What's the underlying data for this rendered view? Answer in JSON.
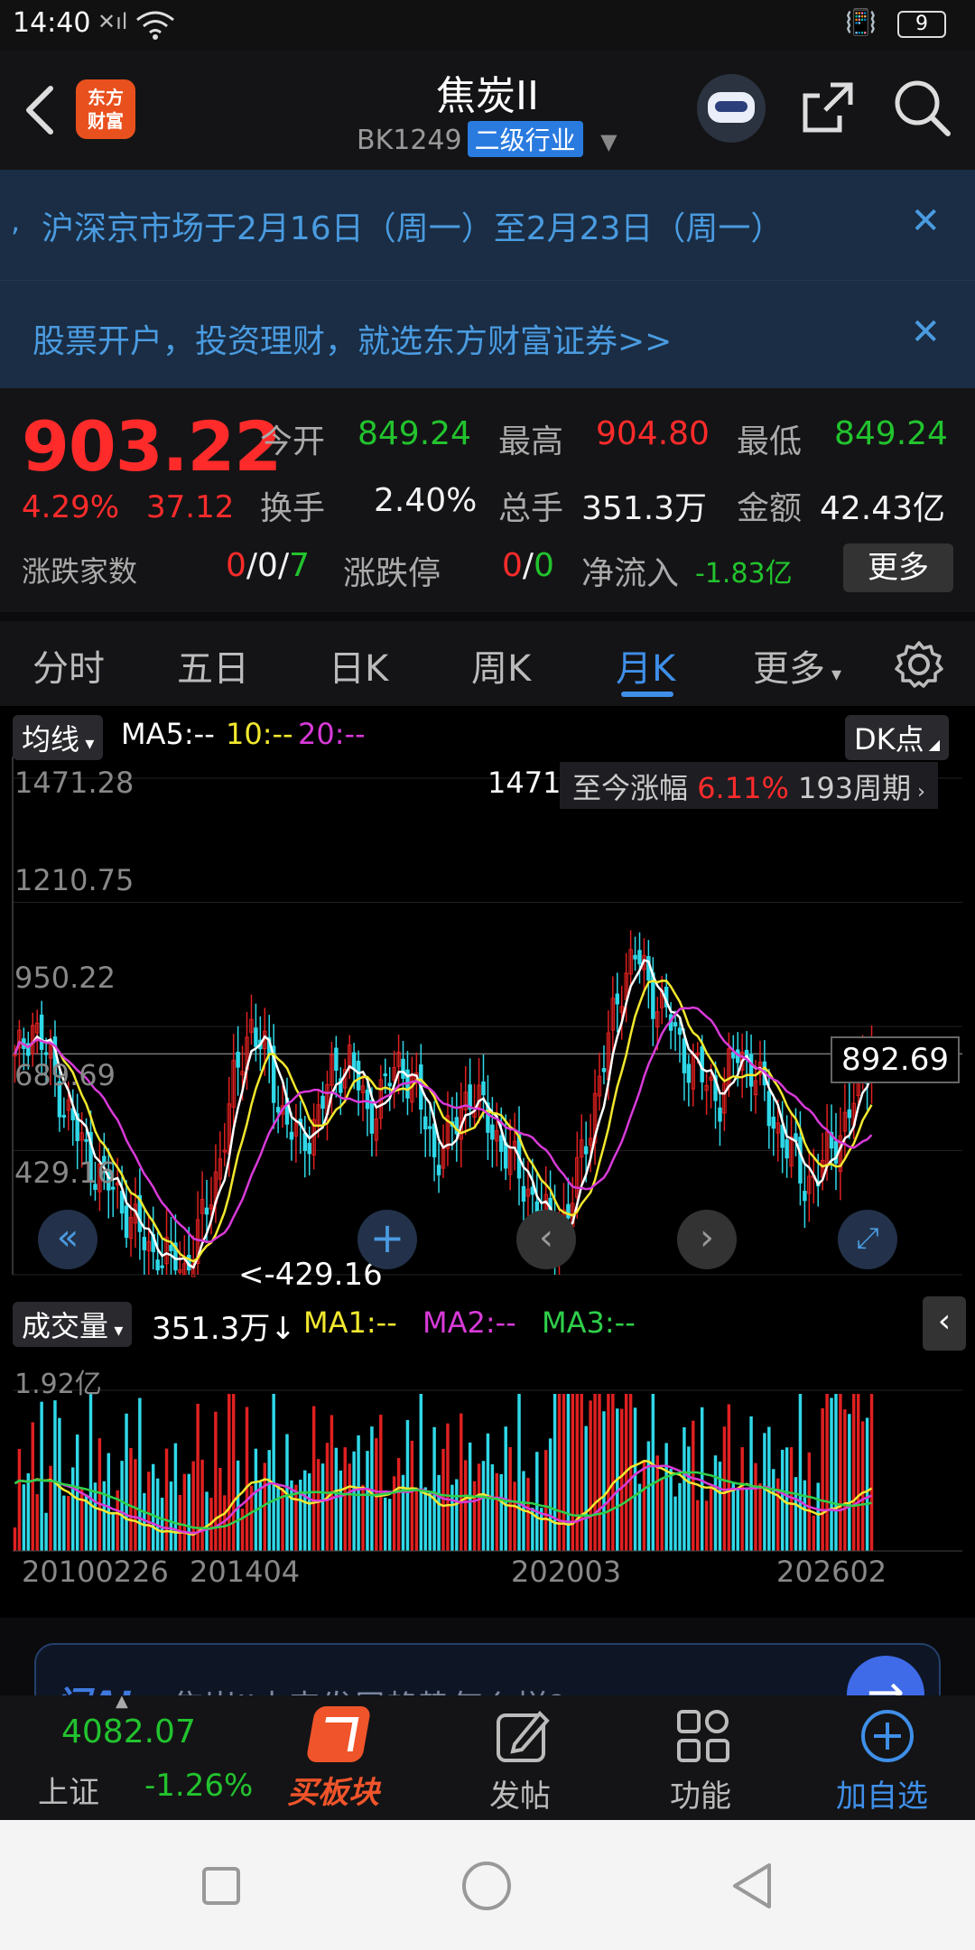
{
  "status_bar": {
    "time": "14:40",
    "battery": "9"
  },
  "header": {
    "logo_text": [
      "东方",
      "财富"
    ],
    "title": "焦炭II",
    "code": "BK1249",
    "category_tag": "二级行业"
  },
  "banners": [
    {
      "text": "沪深京市场于2月16日（周一）至2月23日（周一）"
    },
    {
      "text": "股票开户，投资理财，就选东方财富证券>>"
    }
  ],
  "quote": {
    "price": "903.22",
    "change_pct": "4.29%",
    "change_abs": "37.12",
    "fields": [
      {
        "label": "今开",
        "value": "849.24",
        "color": "green"
      },
      {
        "label": "最高",
        "value": "904.80",
        "color": "red"
      },
      {
        "label": "最低",
        "value": "849.24",
        "color": "green"
      },
      {
        "label": "换手",
        "value": "2.40%",
        "color": "white"
      },
      {
        "label": "总手",
        "value": "351.3万",
        "color": "white"
      },
      {
        "label": "金额",
        "value": "42.43亿",
        "color": "white"
      }
    ],
    "updown_label": "涨跌家数",
    "updown": {
      "up": "0",
      "flat": "0",
      "down": "7"
    },
    "limit_label": "涨跌停",
    "limit": {
      "up": "0",
      "down": "0"
    },
    "netflow_label": "净流入",
    "netflow": "-1.83亿",
    "more_label": "更多"
  },
  "tabs": [
    "分时",
    "五日",
    "日K",
    "周K",
    "月K",
    "更多"
  ],
  "active_tab": "月K",
  "chart": {
    "ma_selector": "均线",
    "ma_legend": {
      "ma5": "MA5:--",
      "ma10": "10:--",
      "ma20": "20:--"
    },
    "dk_label": "DK点",
    "y_ticks": [
      "1471.28",
      "1210.75",
      "950.22",
      "689.69",
      "429.16"
    ],
    "high_marker": "1471",
    "low_marker": "429.16",
    "period_label": "至今涨幅",
    "period_pct": "6.11%",
    "period_count": "193周期",
    "crosshair_price": "892.69",
    "vol_selector": "成交量",
    "vol_value": "351.3万↓",
    "vol_legend": {
      "ma1": "MA1:--",
      "ma2": "MA2:--",
      "ma3": "MA3:--"
    },
    "vol_y_tick": "1.92亿",
    "x_ticks": [
      "20100226",
      "201404",
      "202003",
      "202602"
    ],
    "colors": {
      "up": "#e02020",
      "down": "#2fd8e8",
      "ma5": "#ffffff",
      "ma10": "#f2e82e",
      "ma20": "#d83ad8",
      "ma3": "#2ed04a"
    }
  },
  "ai_bar": {
    "logo": "问AI",
    "question": "焦炭II未来发展趋势怎么样?"
  },
  "bottom_nav": {
    "index_value": "4082.07",
    "index_name": "上证",
    "index_change": "-1.26%",
    "items": [
      "买板块",
      "发帖",
      "功能",
      "加自选"
    ]
  },
  "chart_data": {
    "type": "candlestick",
    "x_ticks": [
      "20100226",
      "201404",
      "202003",
      "202602"
    ],
    "y_range": [
      429.16,
      1471.28
    ],
    "approx_close_series": [
      870,
      960,
      880,
      780,
      700,
      640,
      600,
      540,
      480,
      460,
      430,
      520,
      640,
      820,
      960,
      880,
      760,
      700,
      760,
      860,
      880,
      760,
      820,
      880,
      800,
      680,
      720,
      820,
      760,
      700,
      640,
      580,
      520,
      560,
      720,
      860,
      1040,
      1100,
      1020,
      960,
      880,
      840,
      800,
      900,
      860,
      760,
      700,
      620,
      650,
      720,
      800,
      903
    ],
    "high": 1471.28,
    "low": 429.16,
    "last": 892.69
  }
}
